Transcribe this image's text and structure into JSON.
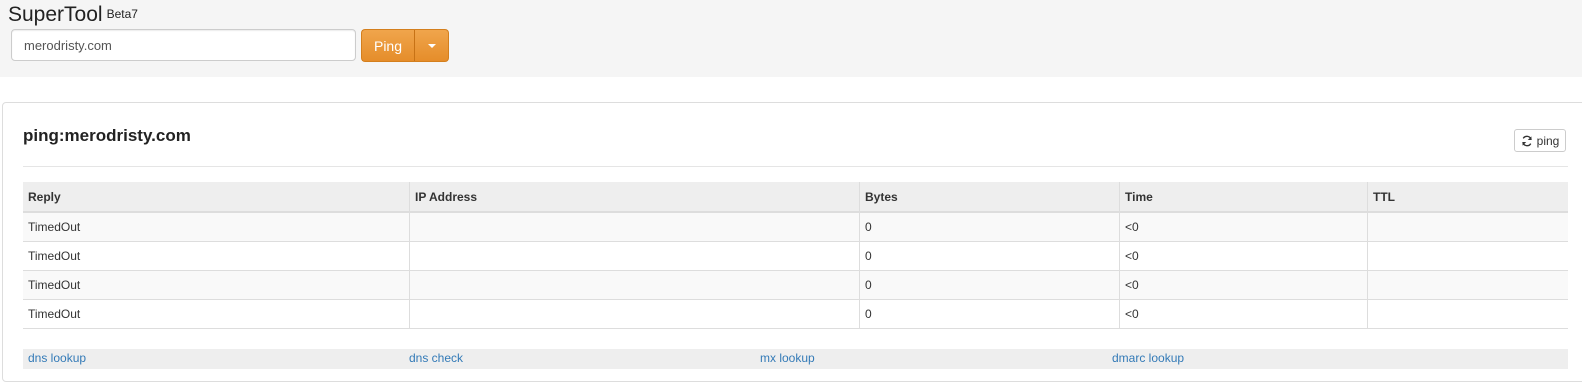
{
  "app": {
    "title": "SuperTool",
    "version_badge": "Beta7"
  },
  "search": {
    "value": "merodristy.com",
    "placeholder": ""
  },
  "toolbar": {
    "ping_label": "Ping"
  },
  "panel": {
    "title": "ping:merodristy.com",
    "refresh_label": "ping"
  },
  "table": {
    "headers": {
      "reply": "Reply",
      "ip": "IP Address",
      "bytes": "Bytes",
      "time": "Time",
      "ttl": "TTL"
    },
    "rows": [
      {
        "reply": "TimedOut",
        "ip": "",
        "bytes": "0",
        "time": "<0",
        "ttl": ""
      },
      {
        "reply": "TimedOut",
        "ip": "",
        "bytes": "0",
        "time": "<0",
        "ttl": ""
      },
      {
        "reply": "TimedOut",
        "ip": "",
        "bytes": "0",
        "time": "<0",
        "ttl": ""
      },
      {
        "reply": "TimedOut",
        "ip": "",
        "bytes": "0",
        "time": "<0",
        "ttl": ""
      }
    ]
  },
  "links": {
    "dns_lookup": "dns lookup",
    "dns_check": "dns check",
    "mx_lookup": "mx lookup",
    "dmarc_lookup": "dmarc lookup"
  },
  "colors": {
    "accent": "#e8922f",
    "link": "#337ab7"
  }
}
